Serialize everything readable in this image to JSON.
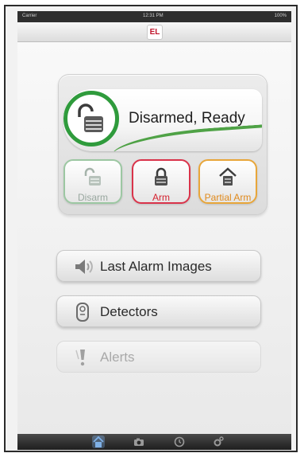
{
  "status_bar": {
    "carrier": "Carrier",
    "time": "12:31 PM",
    "battery": "100%"
  },
  "header": {
    "logo_text": "EL"
  },
  "system": {
    "status": "Disarmed, Ready",
    "status_icon": "unlocked-padlock-icon",
    "status_color": "#2f9b3c",
    "modes": [
      {
        "label": "Disarm",
        "icon": "unlocked-padlock-icon",
        "color": "#9cc7a2"
      },
      {
        "label": "Arm",
        "icon": "locked-padlock-icon",
        "color": "#d9334a"
      },
      {
        "label": "Partial Arm",
        "icon": "home-icon",
        "color": "#e8a63a"
      }
    ]
  },
  "menu": [
    {
      "label": "Last Alarm Images",
      "icon": "speaker-icon",
      "enabled": true
    },
    {
      "label": "Detectors",
      "icon": "detector-icon",
      "enabled": true
    },
    {
      "label": "Alerts",
      "icon": "alert-icon",
      "enabled": false
    }
  ],
  "tabs": [
    {
      "icon": "home-icon",
      "active": true
    },
    {
      "icon": "camera-icon",
      "active": false
    },
    {
      "icon": "clock-icon",
      "active": false
    },
    {
      "icon": "gear-icon",
      "active": false
    }
  ]
}
